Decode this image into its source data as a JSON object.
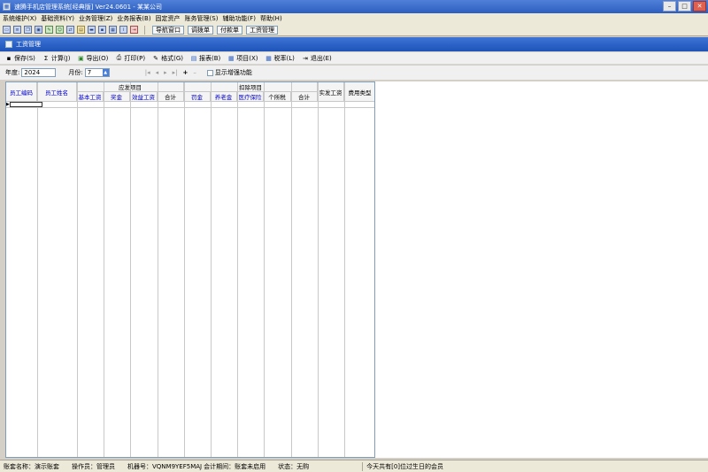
{
  "window": {
    "title": "速腾手机店管理系统[经典版] Ver24.0601 - 某某公司"
  },
  "menu": [
    "系统维护(X)",
    "基础资料(Y)",
    "业务管理(Z)",
    "业务报表(B)",
    "固定资产",
    "账务管理(S)",
    "辅助功能(F)",
    "帮助(H)"
  ],
  "toolbar": {
    "nav_buttons": [
      "导航窗口",
      "调拨单",
      "付款单",
      "工资管理"
    ]
  },
  "panel": {
    "title": "工资管理"
  },
  "actions": [
    {
      "label": "保存(S)",
      "icon": "save-icon"
    },
    {
      "label": "计算(J)",
      "icon": "sum-icon"
    },
    {
      "label": "导出(O)",
      "icon": "export-icon"
    },
    {
      "label": "打印(P)",
      "icon": "print-icon"
    },
    {
      "label": "格式(G)",
      "icon": "format-icon"
    },
    {
      "label": "报表(B)",
      "icon": "report-icon"
    },
    {
      "label": "项目(X)",
      "icon": "project-icon"
    },
    {
      "label": "税率(L)",
      "icon": "taxrate-icon"
    },
    {
      "label": "退出(E)",
      "icon": "exit-icon"
    }
  ],
  "filter": {
    "year_label": "年度:",
    "year": "2024",
    "month_label": "月份:",
    "month": "7",
    "checkbox_label": "显示增强功能"
  },
  "table": {
    "group_payable": "应发项目",
    "group_deduct": "扣除项目",
    "col_emp_code": "员工编码",
    "col_emp_name": "员工姓名",
    "col_base": "基本工资",
    "col_bonus": "奖金",
    "col_perf": "效益工资",
    "col_total1": "合计",
    "col_fine": "罚金",
    "col_pension": "养老金",
    "col_medical": "医疗保险",
    "col_tax": "个所税",
    "col_total2": "合计",
    "col_net": "实发工资",
    "col_type": "费用类型"
  },
  "status": {
    "account": "账套名称：演示账套",
    "operator": "操作员：管理员",
    "machine": "机器号：VQNM9YEF5MAJ",
    "period": "会计期间：账套未启用",
    "state": "状态：无购",
    "birthday": "今天共有[0]位过生日的会员"
  }
}
